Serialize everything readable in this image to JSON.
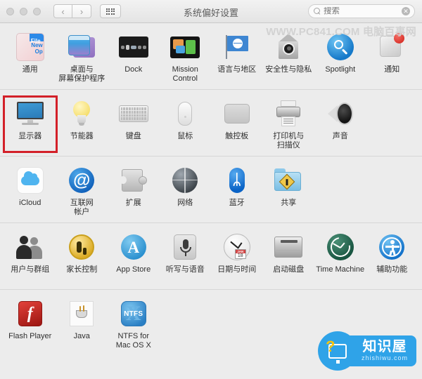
{
  "window": {
    "title": "系统偏好设置",
    "traffic_lights": [
      "close",
      "minimize",
      "zoom"
    ],
    "nav_back": "‹",
    "nav_forward": "›",
    "grid_button": "show-all-grid"
  },
  "search": {
    "placeholder": "搜索",
    "value": "",
    "clear_label": "✕"
  },
  "watermark": {
    "top_text": "WWW.PC841.COM 电脑百事网",
    "badge_cn": "知识屋",
    "badge_en": "zhishiwu.com"
  },
  "highlight_color": "#d32029",
  "rows": [
    {
      "name": "personal",
      "panes": [
        {
          "label": "通用",
          "icon": "general-icon",
          "highlighted": false
        },
        {
          "label": "桌面与\n屏幕保护程序",
          "icon": "desktop-screensaver-icon",
          "highlighted": false
        },
        {
          "label": "Dock",
          "icon": "dock-icon",
          "highlighted": false
        },
        {
          "label": "Mission\nControl",
          "icon": "mission-control-icon",
          "highlighted": false
        },
        {
          "label": "语言与地区",
          "icon": "language-region-icon",
          "highlighted": false
        },
        {
          "label": "安全性与隐私",
          "icon": "security-privacy-icon",
          "highlighted": false
        },
        {
          "label": "Spotlight",
          "icon": "spotlight-icon",
          "highlighted": false
        },
        {
          "label": "通知",
          "icon": "notifications-icon",
          "highlighted": false
        }
      ]
    },
    {
      "name": "hardware",
      "panes": [
        {
          "label": "显示器",
          "icon": "displays-icon",
          "highlighted": true
        },
        {
          "label": "节能器",
          "icon": "energy-saver-icon",
          "highlighted": false
        },
        {
          "label": "键盘",
          "icon": "keyboard-icon",
          "highlighted": false
        },
        {
          "label": "鼠标",
          "icon": "mouse-icon",
          "highlighted": false
        },
        {
          "label": "触控板",
          "icon": "trackpad-icon",
          "highlighted": false
        },
        {
          "label": "打印机与\n扫描仪",
          "icon": "printers-scanners-icon",
          "highlighted": false
        },
        {
          "label": "声音",
          "icon": "sound-icon",
          "highlighted": false
        }
      ]
    },
    {
      "name": "internet-wireless",
      "panes": [
        {
          "label": "iCloud",
          "icon": "icloud-icon",
          "highlighted": false
        },
        {
          "label": "互联网\n帐户",
          "icon": "internet-accounts-icon",
          "highlighted": false
        },
        {
          "label": "扩展",
          "icon": "extensions-icon",
          "highlighted": false
        },
        {
          "label": "网络",
          "icon": "network-icon",
          "highlighted": false
        },
        {
          "label": "蓝牙",
          "icon": "bluetooth-icon",
          "highlighted": false
        },
        {
          "label": "共享",
          "icon": "sharing-icon",
          "highlighted": false
        }
      ]
    },
    {
      "name": "system",
      "panes": [
        {
          "label": "用户与群组",
          "icon": "users-groups-icon",
          "highlighted": false
        },
        {
          "label": "家长控制",
          "icon": "parental-controls-icon",
          "highlighted": false
        },
        {
          "label": "App Store",
          "icon": "app-store-icon",
          "highlighted": false
        },
        {
          "label": "听写与语音",
          "icon": "dictation-speech-icon",
          "highlighted": false
        },
        {
          "label": "日期与时间",
          "icon": "date-time-icon",
          "highlighted": false
        },
        {
          "label": "启动磁盘",
          "icon": "startup-disk-icon",
          "highlighted": false
        },
        {
          "label": "Time Machine",
          "icon": "time-machine-icon",
          "highlighted": false
        },
        {
          "label": "辅助功能",
          "icon": "accessibility-icon",
          "highlighted": false
        }
      ]
    },
    {
      "name": "other",
      "panes": [
        {
          "label": "Flash Player",
          "icon": "flash-player-icon",
          "highlighted": false
        },
        {
          "label": "Java",
          "icon": "java-icon",
          "highlighted": false
        },
        {
          "label": "NTFS for\nMac OS X",
          "icon": "ntfs-icon",
          "highlighted": false
        }
      ]
    }
  ]
}
